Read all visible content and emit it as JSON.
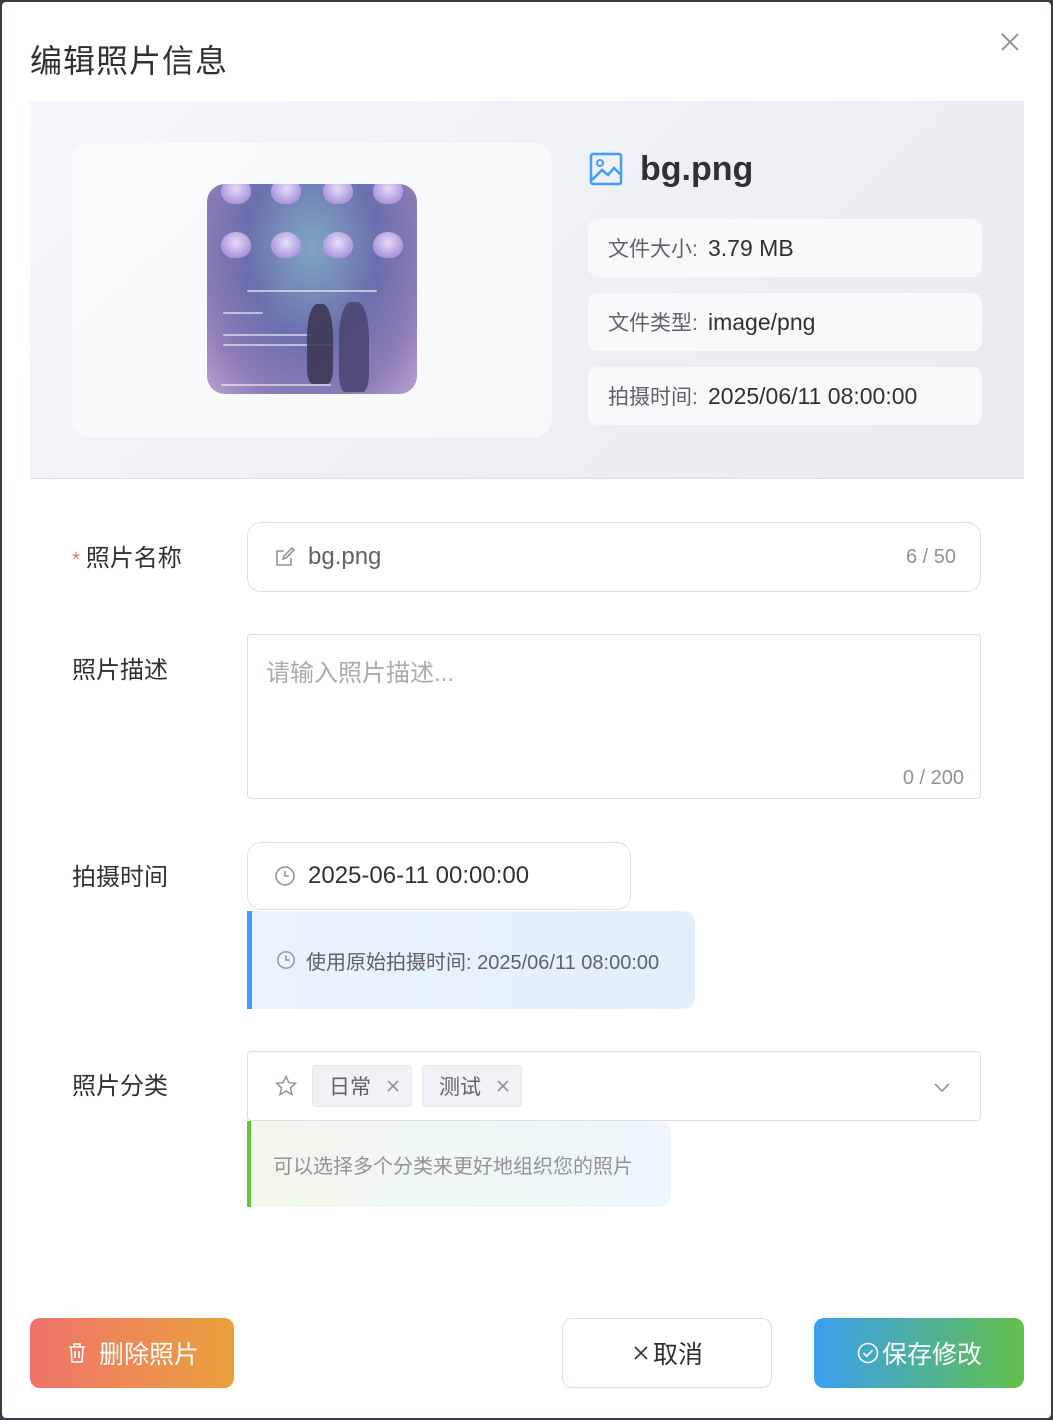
{
  "dialog": {
    "title": "编辑照片信息"
  },
  "file": {
    "name": "bg.png",
    "meta": [
      {
        "label": "文件大小:",
        "value": "3.79 MB"
      },
      {
        "label": "文件类型:",
        "value": "image/png"
      },
      {
        "label": "拍摄时间:",
        "value": "2025/06/11 08:00:00"
      }
    ]
  },
  "form": {
    "name": {
      "label": "照片名称",
      "required_mark": "*",
      "value": "bg.png",
      "counter": "6 / 50"
    },
    "description": {
      "label": "照片描述",
      "placeholder": "请输入照片描述...",
      "counter": "0 / 200"
    },
    "shot_time": {
      "label": "拍摄时间",
      "value": "2025-06-11 00:00:00",
      "hint": "使用原始拍摄时间: 2025/06/11 08:00:00"
    },
    "category": {
      "label": "照片分类",
      "tags": [
        "日常",
        "测试"
      ],
      "hint": "可以选择多个分类来更好地组织您的照片"
    }
  },
  "buttons": {
    "delete": "删除照片",
    "cancel": "取消",
    "save": "保存修改"
  },
  "colors": {
    "accent_blue": "#409eff",
    "success_green": "#67c23a",
    "danger_red": "#f56c6c"
  }
}
